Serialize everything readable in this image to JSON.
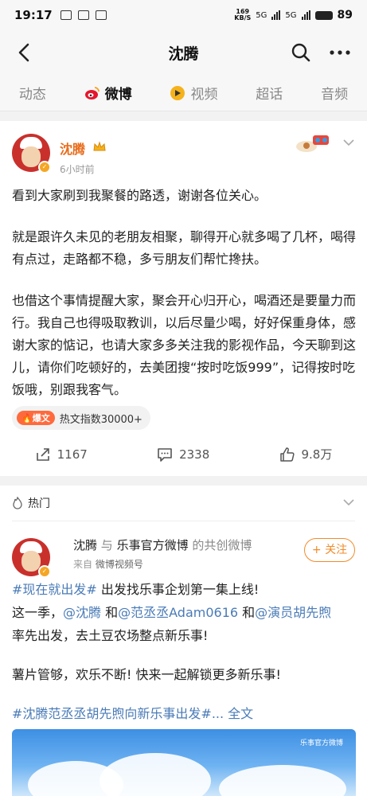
{
  "status": {
    "time": "19:17",
    "speed_num": "169",
    "speed_unit": "KB/S",
    "signal_1": "5G",
    "signal_2": "5G",
    "battery": "89"
  },
  "nav": {
    "title": "沈腾"
  },
  "tabs": [
    {
      "label": "动态"
    },
    {
      "label": "微博"
    },
    {
      "label": "视频"
    },
    {
      "label": "超话"
    },
    {
      "label": "音频"
    }
  ],
  "post1": {
    "author": "沈腾",
    "time": "6小时前",
    "paragraphs": [
      "看到大家刷到我聚餐的路透，谢谢各位关心。",
      "就是跟许久未见的老朋友相聚，聊得开心就多喝了几杯，喝得有点过，走路都不稳，多亏朋友们帮忙搀扶。",
      "也借这个事情提醒大家，聚会开心归开心，喝酒还是要量力而行。我自己也得吸取教训，以后尽量少喝，好好保重身体，感谢大家的惦记，也请大家多多关注我的影视作品，今天聊到这儿，请你们吃顿好的，去美团搜“按时吃饭999”，记得按时吃饭哦，别跟我客气。"
    ],
    "hot_badge": "爆文",
    "hot_index": "热文指数30000+",
    "reposts": "1167",
    "comments": "2338",
    "likes": "9.8万"
  },
  "hot": {
    "header": "热门",
    "author1": "沈腾",
    "connector": "与",
    "author2": "乐事官方微博",
    "suffix": "的共创微博",
    "source_prefix": "来自",
    "source": "微博视频号",
    "follow": "+ 关注",
    "line1_tag": "#现在就出发#",
    "line1_rest": " 出发找乐事企划第一集上线!",
    "line2_a": "这一季，",
    "line2_m1": "@沈腾",
    "line2_and1": " 和",
    "line2_m2": "@范丞丞Adam0616",
    "line2_and2": " 和",
    "line2_m3": "@演员胡先煦",
    "line3": "率先出发，去土豆农场整点新乐事!",
    "line4": "薯片管够，欢乐不断! 快来一起解锁更多新乐事!",
    "line5_tag": "#沈腾范丞丞胡先煦向新乐事出发#...",
    "line5_more": " 全文",
    "video_watermark": "乐事官方微博"
  },
  "colors": {
    "accent_orange": "#e86b1a",
    "link_blue": "#4a7bb7",
    "follow_orange": "#f28b2a"
  }
}
